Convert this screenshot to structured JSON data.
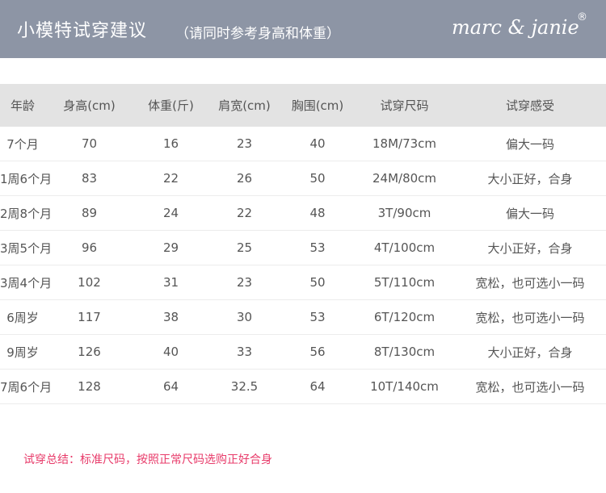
{
  "header": {
    "title": "小模特试穿建议",
    "subtitle": "（请同时参考身高和体重）",
    "brand": "marc & janie",
    "brand_mark": "®"
  },
  "table": {
    "columns": [
      "年龄",
      "身高(cm)",
      "体重(斤)",
      "肩宽(cm)",
      "胸围(cm)",
      "试穿尺码",
      "试穿感受"
    ],
    "rows": [
      [
        "7个月",
        "70",
        "16",
        "23",
        "40",
        "18M/73cm",
        "偏大一码"
      ],
      [
        "1周6个月",
        "83",
        "22",
        "26",
        "50",
        "24M/80cm",
        "大小正好，合身"
      ],
      [
        "2周8个月",
        "89",
        "24",
        "22",
        "48",
        "3T/90cm",
        "偏大一码"
      ],
      [
        "3周5个月",
        "96",
        "29",
        "25",
        "53",
        "4T/100cm",
        "大小正好，合身"
      ],
      [
        "3周4个月",
        "102",
        "31",
        "23",
        "50",
        "5T/110cm",
        "宽松，也可选小一码"
      ],
      [
        "6周岁",
        "117",
        "38",
        "30",
        "53",
        "6T/120cm",
        "宽松，也可选小一码"
      ],
      [
        "9周岁",
        "126",
        "40",
        "33",
        "56",
        "8T/130cm",
        "大小正好，合身"
      ],
      [
        "7周6个月",
        "128",
        "64",
        "32.5",
        "64",
        "10T/140cm",
        "宽松，也可选小一码"
      ]
    ]
  },
  "summary": "试穿总结：标准尺码，按照正常尺码选购正好合身",
  "colors": {
    "header_bg": "#8d95a5",
    "table_header_bg": "#e3e3e3",
    "summary_text": "#e83b6a"
  }
}
